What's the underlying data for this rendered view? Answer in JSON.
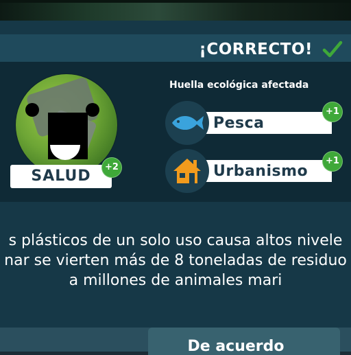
{
  "header": {
    "result_text": "¡CORRECTO!",
    "check_icon": "checkmark-icon",
    "check_color": "#3fa839"
  },
  "health": {
    "label": "SALUD",
    "delta": "+2",
    "planet_icon": "planet-face-icon"
  },
  "footprint": {
    "title": "Huella ecológica afectada",
    "items": [
      {
        "label": "Pesca",
        "delta": "+1",
        "icon": "fish-icon"
      },
      {
        "label": "Urbanismo",
        "delta": "+1",
        "icon": "house-icon"
      }
    ]
  },
  "message": {
    "lines": [
      "s plásticos de un solo uso causa altos nivele",
      "nar se vierten más de 8 toneladas de residuo",
      "a millones de animales mari"
    ]
  },
  "footer": {
    "accept_label": "De acuerdo"
  },
  "colors": {
    "panel": "#163847",
    "badge": "#3fa839",
    "fish": "#3aa3dc",
    "house": "#f29b1d"
  }
}
